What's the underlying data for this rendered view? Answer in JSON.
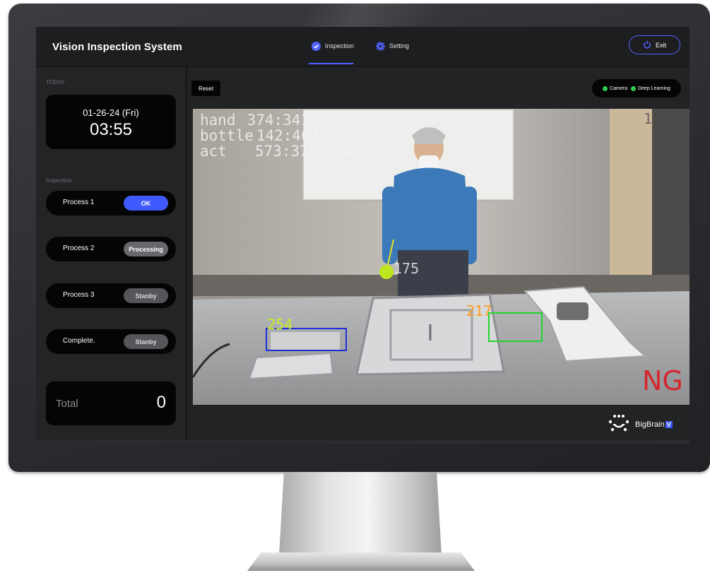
{
  "app": {
    "title": "Vision Inspection System"
  },
  "nav": {
    "tabs": [
      {
        "label": "Inspection",
        "icon": "check-circle-icon",
        "active": true
      },
      {
        "label": "Setting",
        "icon": "gear-icon",
        "active": false
      }
    ],
    "exit_label": "Exit",
    "accent": "#4f63ff"
  },
  "today": {
    "section_label": "TODAY",
    "date": "01-26-24 (Fri)",
    "time": "03:55"
  },
  "inspection": {
    "section_label": "Inspection",
    "processes": [
      {
        "label": "Process 1",
        "status": "OK"
      },
      {
        "label": "Process 2",
        "status": "Processing"
      },
      {
        "label": "Process 3",
        "status": "Stanby"
      },
      {
        "label": "Complete.",
        "status": "Stanby"
      }
    ],
    "total_label": "Total",
    "total_value": "0"
  },
  "main": {
    "reset_label": "Reset",
    "status": [
      {
        "label": "Camera",
        "color": "#2ecc4f"
      },
      {
        "label": "Deep Learning",
        "color": "#2ecc4f"
      }
    ]
  },
  "camera_overlay": {
    "lines": [
      {
        "key": "hand",
        "value": "374:341"
      },
      {
        "key": "bottle",
        "value": "142:404"
      },
      {
        "key": "act",
        "value": "573:375.484.382"
      }
    ],
    "corner": "1",
    "point_label": "175",
    "box_blue_label": "254",
    "box_green_label": "217",
    "result": "NG",
    "result_color": "#d6262d",
    "blue_color": "#1f2fd8",
    "green_color": "#23d62e",
    "label_yellow": "#c9f021",
    "label_orange": "#ff9b1a"
  },
  "brand": {
    "name": "BigBrain",
    "badge": "V"
  }
}
